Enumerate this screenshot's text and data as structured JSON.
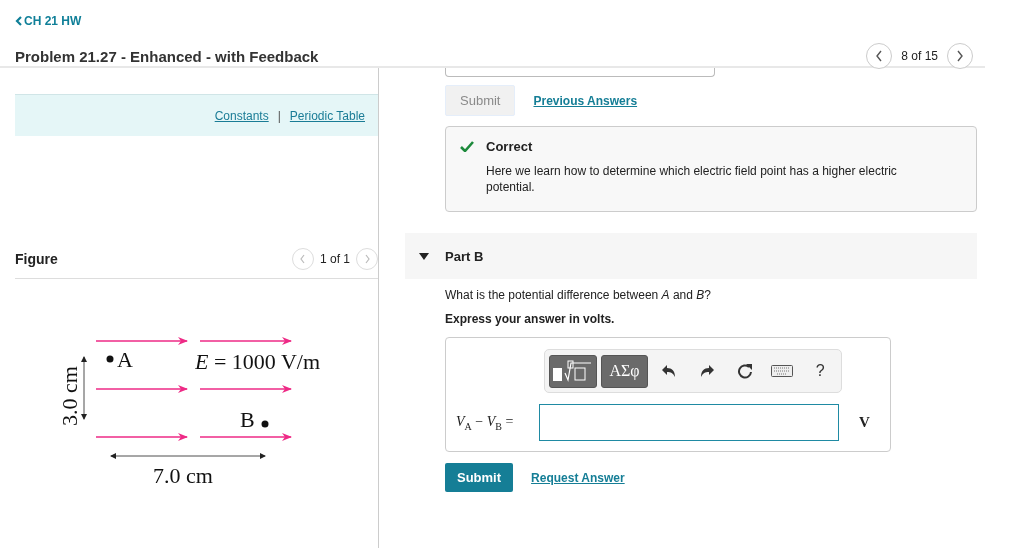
{
  "back_link": {
    "label": "CH 21 HW"
  },
  "title": "Problem 21.27 - Enhanced - with Feedback",
  "pager": {
    "label": "8 of 15"
  },
  "resources": {
    "links": [
      "Constants",
      "Periodic Table"
    ],
    "separator": "|"
  },
  "figure": {
    "title": "Figure",
    "pager": "1 of 1",
    "point_a": "A",
    "point_b": "B",
    "field_label": "*E* = 1000 V/m",
    "width_label": "7.0 cm",
    "height_label": "3.0 cm"
  },
  "part_a": {
    "submit": {
      "label": "Submit",
      "disabled": true
    },
    "link": "Previous Answers"
  },
  "feedback": {
    "status": "Correct",
    "text": "Here we learn how to determine which electric field point has a higher electric potential."
  },
  "part_b": {
    "title": "Part B",
    "expanded": true,
    "question": "What is the potential difference between *A* and *B*?",
    "instruction": "Express your answer in volts.",
    "toolbar": {
      "symbols": "ΑΣφ",
      "help": "?"
    },
    "answer_label": "*V*$_{A}$ − *V*$_{B}$ =",
    "unit": "V",
    "submit": {
      "label": "Submit",
      "disabled": false
    },
    "link": "Request Answer"
  }
}
